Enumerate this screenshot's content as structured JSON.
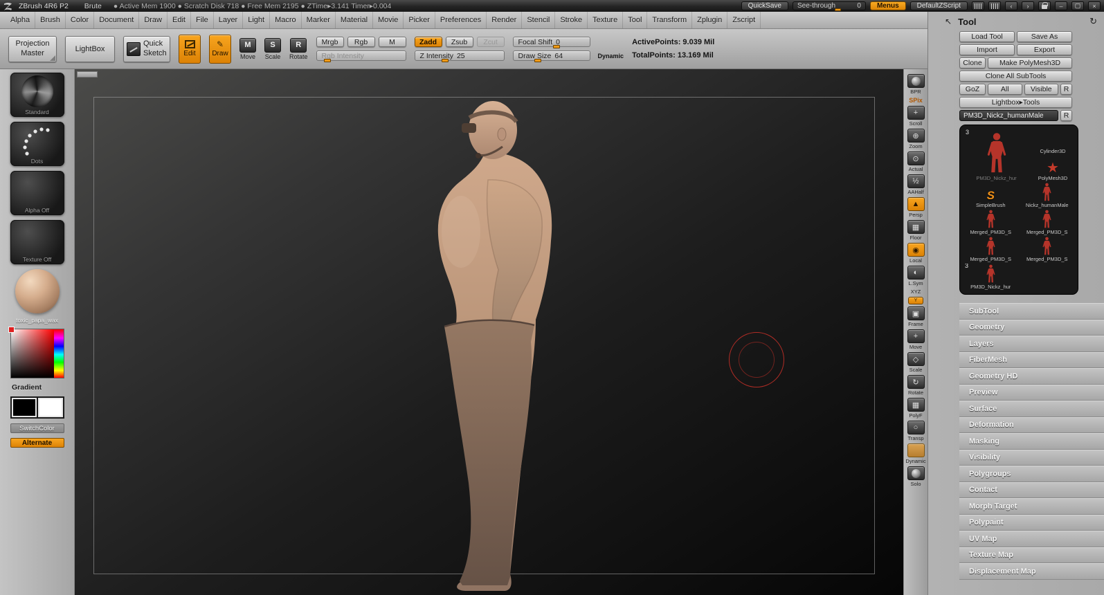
{
  "colors": {
    "accent": "#ef9a16",
    "cursor_red": "#c43a30",
    "skin": "#c9a189",
    "pants": "#8a6f5d"
  },
  "titlebar": {
    "app_title": "ZBrush 4R6 P2",
    "doc_name": "Brute",
    "stats": "● Active Mem 1900   ● Scratch Disk 718   ● Free Mem 2195   ● ZTime▸3.141  Timer▸0.004",
    "quicksave": "QuickSave",
    "see_through": "See-through",
    "see_through_value": "0",
    "menus": "Menus",
    "default_zscript": "DefaultZScript"
  },
  "menubar": [
    "Alpha",
    "Brush",
    "Color",
    "Document",
    "Draw",
    "Edit",
    "File",
    "Layer",
    "Light",
    "Macro",
    "Marker",
    "Material",
    "Movie",
    "Picker",
    "Preferences",
    "Render",
    "Stencil",
    "Stroke",
    "Texture",
    "Tool",
    "Transform",
    "Zplugin",
    "Zscript"
  ],
  "shelf": {
    "projection_master": "Projection Master",
    "lightbox": "LightBox",
    "quick_sketch": "Quick Sketch",
    "edit": "Edit",
    "draw": "Draw",
    "move": "Move",
    "move_badge": "M",
    "scale": "Scale",
    "scale_badge": "S",
    "rotate": "Rotate",
    "rotate_badge": "R",
    "mrgb": "Mrgb",
    "rgb": "Rgb",
    "m": "M",
    "rgb_intensity": "Rgb Intensity",
    "zadd": "Zadd",
    "zsub": "Zsub",
    "zcut": "Zcut",
    "z_intensity": {
      "label": "Z Intensity",
      "value": "25"
    },
    "focal_shift": {
      "label": "Focal Shift",
      "value": "0"
    },
    "draw_size": {
      "label": "Draw Size",
      "value": "64"
    },
    "dynamic": "Dynamic",
    "active_points": "ActivePoints: 9.039 Mil",
    "total_points": "TotalPoints: 13.169 Mil"
  },
  "left_tray": {
    "brush": "Standard",
    "stroke": "Dots",
    "alpha": "Alpha Off",
    "texture": "Texture Off",
    "material": "toxic_papa_wax",
    "gradient": "Gradient",
    "switch_color": "SwitchColor",
    "alternate": "Alternate"
  },
  "right_strip": [
    {
      "label": "BPR",
      "active": false
    },
    {
      "label": "SPix",
      "active": true
    },
    {
      "label": "Scroll",
      "active": false
    },
    {
      "label": "Zoom",
      "active": false
    },
    {
      "label": "Actual",
      "active": false
    },
    {
      "label": "AAHalf",
      "active": false
    },
    {
      "label": "Persp",
      "active": true
    },
    {
      "label": "Floor",
      "active": false
    },
    {
      "label": "Local",
      "active": true
    },
    {
      "label": "L.Sym",
      "active": false
    },
    {
      "label": "XYZ",
      "active": false
    },
    {
      "label": "Y",
      "active": true
    },
    {
      "label": "Frame",
      "active": false
    },
    {
      "label": "Move",
      "active": false
    },
    {
      "label": "Scale",
      "active": false
    },
    {
      "label": "Rotate",
      "active": false
    },
    {
      "label": "PolyF",
      "active": false
    },
    {
      "label": "Transp",
      "active": false
    },
    {
      "label": "Dynamic",
      "active": false
    },
    {
      "label": "Solo",
      "active": false
    }
  ],
  "tool_panel": {
    "title": "Tool",
    "load_tool": "Load Tool",
    "save_as": "Save As",
    "import": "Import",
    "export": "Export",
    "clone": "Clone",
    "make_polymesh": "Make PolyMesh3D",
    "clone_all": "Clone All SubTools",
    "goz": "GoZ",
    "all": "All",
    "visible": "Visible",
    "r": "R",
    "lightbox_tools": "Lightbox▸Tools",
    "current_tool": "PM3D_Nickz_humanMale",
    "current_tool_r": "R",
    "thumbnails": [
      {
        "label": "PM3D_Nickz_hur",
        "badge": "3"
      },
      {
        "label": "Cylinder3D"
      },
      {
        "label": "PolyMesh3D"
      },
      {
        "label": "SimpleBrush"
      },
      {
        "label": "Nickz_humanMale"
      },
      {
        "label": "Merged_PM3D_S"
      },
      {
        "label": "Merged_PM3D_S"
      },
      {
        "label": "Merged_PM3D_S"
      },
      {
        "label": "Merged_PM3D_S"
      },
      {
        "label": "PM3D_Nickz_hur",
        "badge": "3"
      }
    ],
    "sections": [
      "SubTool",
      "Geometry",
      "Layers",
      "FiberMesh",
      "Geometry HD",
      "Preview",
      "Surface",
      "Deformation",
      "Masking",
      "Visibility",
      "Polygroups",
      "Contact",
      "Morph Target",
      "Polypaint",
      "UV Map",
      "Texture Map",
      "Displacement Map"
    ]
  }
}
